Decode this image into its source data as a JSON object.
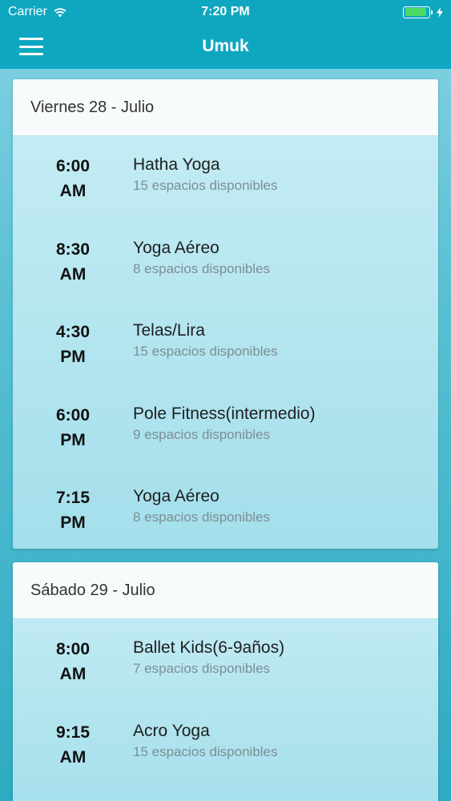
{
  "status": {
    "carrier": "Carrier",
    "time": "7:20 PM",
    "battery_level": 0.9,
    "battery_color": "#4cd964"
  },
  "nav": {
    "title": "Umuk",
    "menu_icon": "hamburger-menu-icon"
  },
  "colors": {
    "primary": "#0fa7c0",
    "background_top": "#86d3e4",
    "background_bottom": "#2eabc2"
  },
  "days": [
    {
      "label": "Viernes 28 - Julio",
      "classes": [
        {
          "time": "6:00",
          "period": "AM",
          "name": "Hatha Yoga",
          "spaces": "15 espacios disponibles"
        },
        {
          "time": "8:30",
          "period": "AM",
          "name": "Yoga Aéreo",
          "spaces": "8 espacios disponibles"
        },
        {
          "time": "4:30",
          "period": "PM",
          "name": "Telas/Lira",
          "spaces": "15 espacios disponibles"
        },
        {
          "time": "6:00",
          "period": "PM",
          "name": "Pole Fitness(intermedio)",
          "spaces": "9 espacios disponibles"
        },
        {
          "time": "7:15",
          "period": "PM",
          "name": "Yoga Aéreo",
          "spaces": "8 espacios disponibles"
        }
      ]
    },
    {
      "label": "Sábado 29 - Julio",
      "classes": [
        {
          "time": "8:00",
          "period": "AM",
          "name": "Ballet Kids(6-9años)",
          "spaces": "7 espacios disponibles"
        },
        {
          "time": "9:15",
          "period": "AM",
          "name": "Acro Yoga",
          "spaces": "15 espacios disponibles"
        }
      ]
    }
  ]
}
